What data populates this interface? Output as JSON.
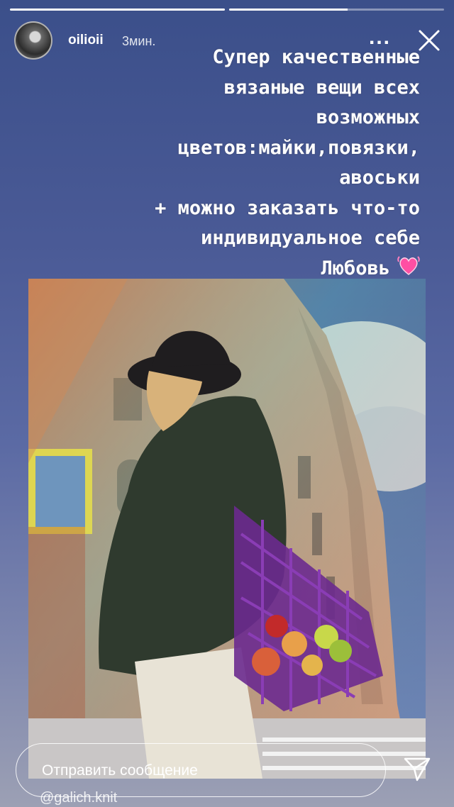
{
  "story": {
    "username": "oilioii",
    "time": "3мин.",
    "more_label": "...",
    "progress": [
      1.0,
      0.55
    ],
    "caption": "Супер качественные\nвязаные вещи всех\nвозможных\nцветов:майки,повязки,\nавоськи\n+  можно заказать что-то\nиндивидуальное себе\nЛюбовь",
    "heart": "💗"
  },
  "reply": {
    "placeholder": "Отправить сообщение"
  },
  "mention": "@galich.knit",
  "icons": {
    "close": "close-icon",
    "send": "send-icon",
    "heart": "heart-icon"
  },
  "colors": {
    "background_top": "#3b4f8a",
    "background_bottom": "#9ca0b4",
    "heart": "#ff4fa3"
  }
}
